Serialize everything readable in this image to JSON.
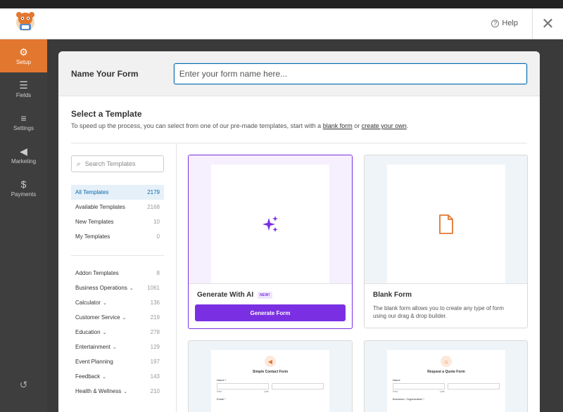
{
  "topbar": {
    "help_label": "Help",
    "close_symbol": "✕"
  },
  "sidebar": {
    "items": [
      {
        "label": "Setup",
        "icon": "gear-icon",
        "active": true
      },
      {
        "label": "Fields",
        "icon": "fields-icon"
      },
      {
        "label": "Settings",
        "icon": "sliders-icon"
      },
      {
        "label": "Marketing",
        "icon": "megaphone-icon"
      },
      {
        "label": "Payments",
        "icon": "dollar-icon"
      }
    ],
    "bottom_icon": "history-icon"
  },
  "modal": {
    "name_label": "Name Your Form",
    "name_placeholder": "Enter your form name here...",
    "name_value": "",
    "template_title": "Select a Template",
    "template_desc_start": "To speed up the process, you can select from one of our pre-made templates, start with a ",
    "blank_link": "blank form",
    "template_desc_mid": " or ",
    "create_link": "create your own",
    "template_desc_end": ".",
    "search_placeholder": "Search Templates",
    "categories_top": [
      {
        "label": "All Templates",
        "count": "2179",
        "active": true
      },
      {
        "label": "Available Templates",
        "count": "2168"
      },
      {
        "label": "New Templates",
        "count": "10"
      },
      {
        "label": "My Templates",
        "count": "0"
      }
    ],
    "categories": [
      {
        "label": "Addon Templates",
        "count": "8",
        "chevron": false
      },
      {
        "label": "Business Operations",
        "count": "1061",
        "chevron": true
      },
      {
        "label": "Calculator",
        "count": "136",
        "chevron": true
      },
      {
        "label": "Customer Service",
        "count": "219",
        "chevron": true
      },
      {
        "label": "Education",
        "count": "278",
        "chevron": true
      },
      {
        "label": "Entertainment",
        "count": "129",
        "chevron": true
      },
      {
        "label": "Event Planning",
        "count": "197",
        "chevron": false
      },
      {
        "label": "Feedback",
        "count": "143",
        "chevron": true
      },
      {
        "label": "Health & Wellness",
        "count": "210",
        "chevron": true
      }
    ],
    "cards": {
      "ai": {
        "title": "Generate With AI",
        "badge": "NEW!",
        "button": "Generate Form"
      },
      "blank": {
        "title": "Blank Form",
        "desc": "The blank form allows you to create any type of form using our drag & drop builder."
      },
      "contact": {
        "preview_title": "Simple Contact Form",
        "name_label": "Name *",
        "first": "First",
        "last": "Last",
        "email_label": "Email *"
      },
      "quote": {
        "preview_title": "Request a Quote Form",
        "name_label": "Name",
        "first": "First",
        "last": "Last",
        "business_label": "Business / Organization *"
      }
    }
  }
}
